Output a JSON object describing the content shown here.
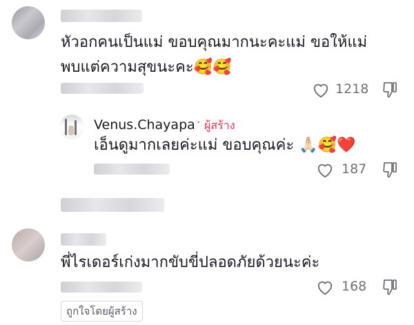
{
  "comments": [
    {
      "text_line1": "หัวอกคนเป็นแม่ ขอบคุณมากนะคะแม่ ขอให้แม่",
      "text_line2": "พบแต่ความสุขนะคะ🥰🥰",
      "likes": "1218"
    },
    {
      "username": "Venus.Chayapa",
      "separator": "·",
      "badge": "ผู้สร้าง",
      "text": "เอ็นดูมากเลยค่ะแม่ ขอบคุณค่ะ 🙏🏻🥰❤️",
      "likes": "187"
    },
    {
      "text": "พี่ไรเดอร์เก่งมากขับขี่ปลอดภัยด้วยนะค่ะ",
      "likes": "168",
      "liked_by_creator": "ถูกใจโดยผู้สร้าง"
    }
  ],
  "icons": {
    "like": "heart-outline-icon",
    "dislike": "thumbs-down-icon"
  },
  "colors": {
    "creator_accent": "#fe2c55",
    "text": "#161823",
    "muted": "#8a8b91"
  }
}
